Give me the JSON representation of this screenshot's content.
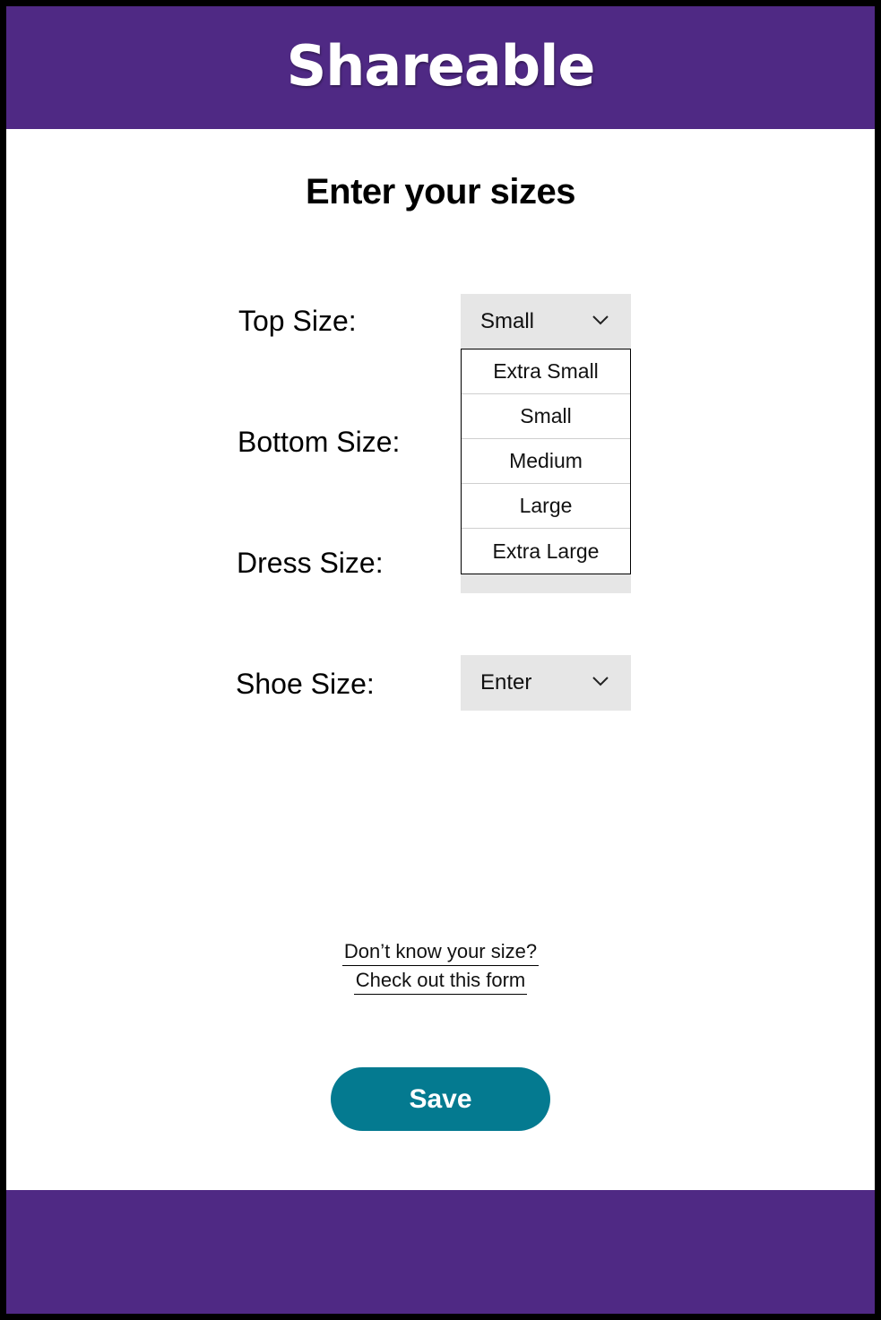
{
  "header": {
    "brand": "Shareable",
    "background_color": "#4f2984"
  },
  "main": {
    "title": "Enter your sizes",
    "fields": [
      {
        "label": "Top Size:",
        "selected": "Small",
        "open": true
      },
      {
        "label": "Bottom Size:"
      },
      {
        "label": "Dress Size:"
      },
      {
        "label": "Shoe Size:",
        "selected": "Enter",
        "open": false
      }
    ],
    "dropdown_options": [
      "Extra Small",
      "Small",
      "Medium",
      "Large",
      "Extra Large"
    ],
    "help_link": {
      "line1": "Don’t know your size?",
      "line2": "Check out this form"
    },
    "save_label": "Save",
    "save_color": "#047a90"
  },
  "icons": {
    "select_chevron": "chevron-down-icon"
  }
}
